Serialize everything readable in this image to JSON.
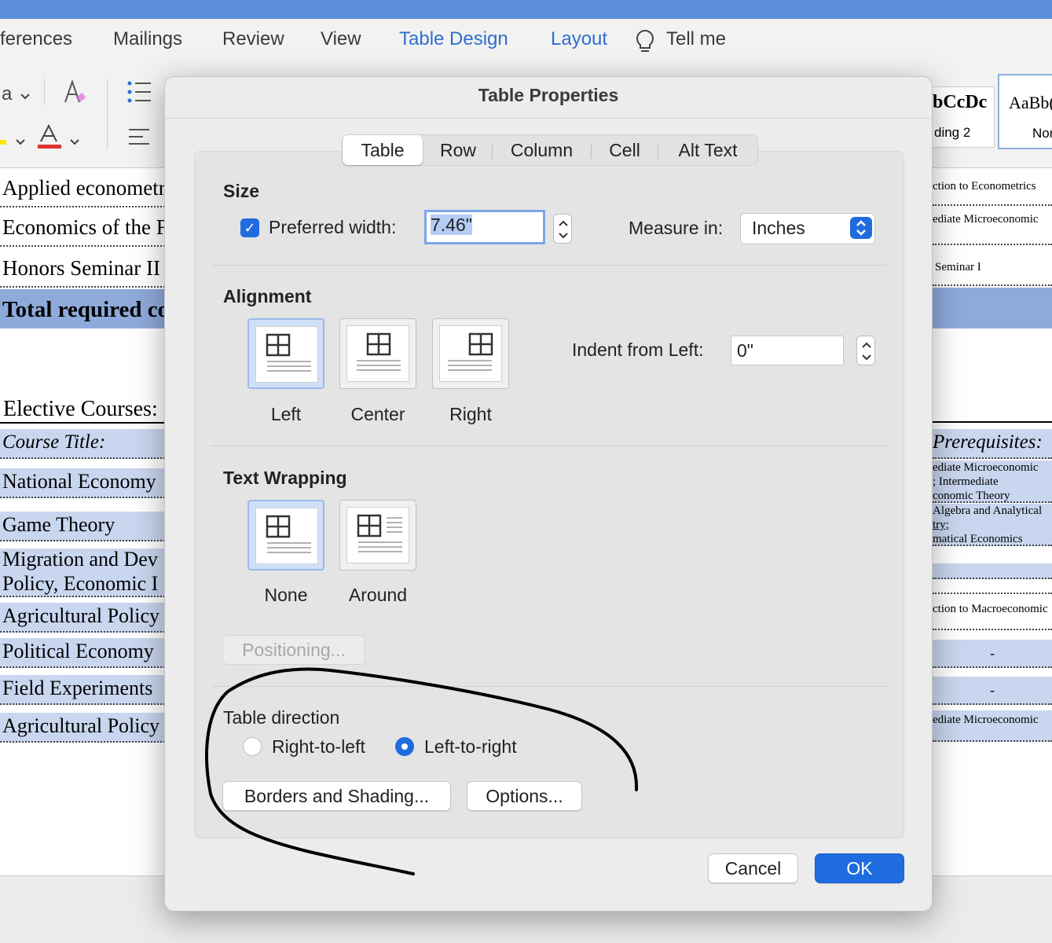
{
  "menu": {
    "items": [
      "ferences",
      "Mailings",
      "Review",
      "View",
      "Table Design",
      "Layout",
      "Tell me"
    ]
  },
  "ribbon": {
    "font_glyph": "a",
    "style_gallery": [
      {
        "preview": "bCcDc",
        "name": "ding 2"
      },
      {
        "preview": "AaBb(",
        "name": "Nor"
      }
    ]
  },
  "document": {
    "left_rows": [
      "Applied econometr",
      "Economics of the F",
      "Honors Seminar II",
      "Total required co"
    ],
    "elective_heading": "Elective Courses:",
    "elective_header": "Course Title:",
    "elective_rows": [
      "National Economy",
      "Game Theory",
      "Migration and Dev",
      "Policy, Economic I",
      "Agricultural Policy",
      "Political Economy",
      "Field Experiments",
      "Agricultural Policy"
    ],
    "right_rows": [
      "ction to Econometrics",
      "ediate Microeconomic",
      "Seminar I"
    ],
    "prereq_header": "Prerequisites:",
    "prereq_rows": [
      "ediate Microeconomic",
      "; Intermediate",
      "conomic Theory",
      "Algebra and Analytical",
      "try;",
      "matical Economics",
      "ction to Macroeconomic",
      "-",
      "-",
      "ediate Microeconomic"
    ]
  },
  "dialog": {
    "title": "Table Properties",
    "tabs": [
      "Table",
      "Row",
      "Column",
      "Cell",
      "Alt Text"
    ],
    "active_tab": "Table",
    "size": {
      "title": "Size",
      "preferred_width_label": "Preferred width:",
      "preferred_width_checked": true,
      "preferred_width_value": "7.46\"",
      "measure_in_label": "Measure in:",
      "measure_in_value": "Inches"
    },
    "alignment": {
      "title": "Alignment",
      "options": [
        "Left",
        "Center",
        "Right"
      ],
      "selected": "Left",
      "indent_label": "Indent from Left:",
      "indent_value": "0\""
    },
    "text_wrapping": {
      "title": "Text Wrapping",
      "options": [
        "None",
        "Around"
      ],
      "selected": "None",
      "positioning_button": "Positioning..."
    },
    "table_direction": {
      "title": "Table direction",
      "options": [
        "Right-to-left",
        "Left-to-right"
      ],
      "selected": "Left-to-right"
    },
    "borders_button": "Borders and Shading...",
    "options_button": "Options...",
    "cancel_button": "Cancel",
    "ok_button": "OK"
  },
  "colors": {
    "accent": "#1f6ce0",
    "title_bar": "#5b8fd9",
    "highlight": "#c9d6ef",
    "total_row": "#8eaadb"
  }
}
